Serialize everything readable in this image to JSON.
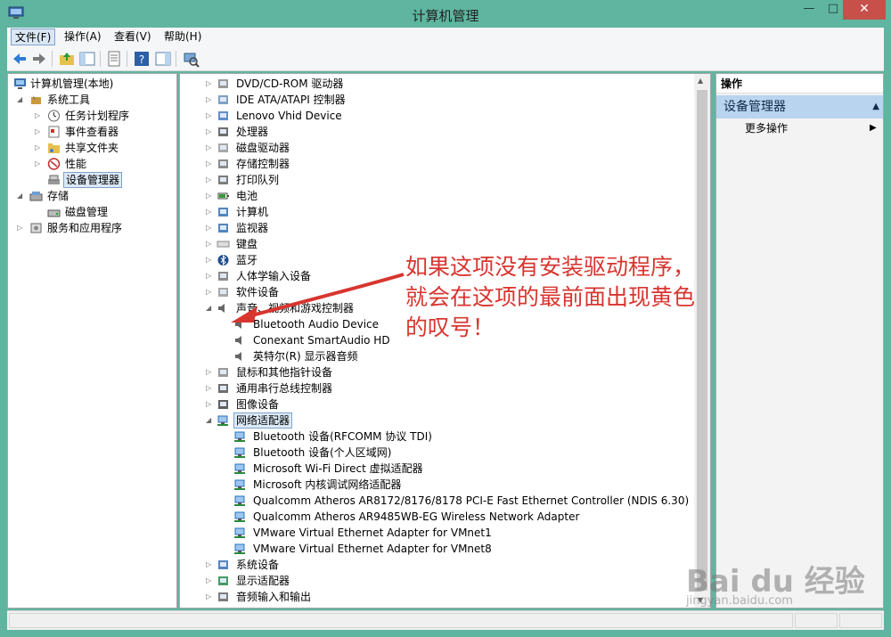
{
  "window": {
    "title": "计算机管理",
    "minimize": "—",
    "maximize": "□",
    "close": "✕"
  },
  "menu": [
    {
      "label": "文件(F)",
      "active": true
    },
    {
      "label": "操作(A)"
    },
    {
      "label": "查看(V)"
    },
    {
      "label": "帮助(H)"
    }
  ],
  "toolbar": [
    "back-arrow-icon",
    "forward-arrow-icon",
    "folder-up-icon",
    "show-hide-tree-icon",
    "properties-icon",
    "help-icon",
    "show-action-pane-icon",
    "scan-hardware-icon"
  ],
  "left_tree": [
    {
      "label": "计算机管理(本地)",
      "icon": "computer-management-icon"
    },
    {
      "label": "系统工具",
      "icon": "system-tools-icon"
    },
    {
      "label": "任务计划程序",
      "icon": "clock-icon"
    },
    {
      "label": "事件查看器",
      "icon": "event-viewer-icon"
    },
    {
      "label": "共享文件夹",
      "icon": "shared-folder-icon"
    },
    {
      "label": "性能",
      "icon": "performance-icon"
    },
    {
      "label": "设备管理器",
      "icon": "device-manager-icon",
      "selected": true
    },
    {
      "label": "存储",
      "icon": "storage-icon"
    },
    {
      "label": "磁盘管理",
      "icon": "disk-management-icon"
    },
    {
      "label": "服务和应用程序",
      "icon": "services-icon"
    }
  ],
  "device_tree": [
    {
      "label": "DVD/CD-ROM 驱动器",
      "icon": "dvd-drive-icon"
    },
    {
      "label": "IDE ATA/ATAPI 控制器",
      "icon": "ide-controller-icon"
    },
    {
      "label": "Lenovo Vhid Device",
      "icon": "hid-device-icon"
    },
    {
      "label": "处理器",
      "icon": "processor-icon"
    },
    {
      "label": "磁盘驱动器",
      "icon": "disk-drive-icon"
    },
    {
      "label": "存储控制器",
      "icon": "storage-controller-icon"
    },
    {
      "label": "打印队列",
      "icon": "printer-icon"
    },
    {
      "label": "电池",
      "icon": "battery-icon"
    },
    {
      "label": "计算机",
      "icon": "computer-icon"
    },
    {
      "label": "监视器",
      "icon": "monitor-icon"
    },
    {
      "label": "键盘",
      "icon": "keyboard-icon"
    },
    {
      "label": "蓝牙",
      "icon": "bluetooth-icon"
    },
    {
      "label": "人体学输入设备",
      "icon": "hid-icon"
    },
    {
      "label": "软件设备",
      "icon": "software-device-icon"
    },
    {
      "label": "声音、视频和游戏控制器",
      "icon": "speaker-icon",
      "expanded": true
    },
    {
      "label": "Bluetooth Audio Device",
      "icon": "speaker-icon",
      "child": true
    },
    {
      "label": "Conexant SmartAudio HD",
      "icon": "speaker-icon",
      "child": true
    },
    {
      "label": "英特尔(R) 显示器音频",
      "icon": "speaker-icon",
      "child": true
    },
    {
      "label": "鼠标和其他指针设备",
      "icon": "mouse-icon"
    },
    {
      "label": "通用串行总线控制器",
      "icon": "usb-icon"
    },
    {
      "label": "图像设备",
      "icon": "camera-icon"
    },
    {
      "label": "网络适配器",
      "icon": "network-adapter-icon",
      "expanded": true,
      "selected": true
    },
    {
      "label": "Bluetooth 设备(RFCOMM 协议 TDI)",
      "icon": "network-adapter-icon",
      "child": true
    },
    {
      "label": "Bluetooth 设备(个人区域网)",
      "icon": "network-adapter-icon",
      "child": true
    },
    {
      "label": "Microsoft Wi-Fi Direct 虚拟适配器",
      "icon": "network-adapter-icon",
      "child": true
    },
    {
      "label": "Microsoft 内核调试网络适配器",
      "icon": "network-adapter-icon",
      "child": true
    },
    {
      "label": "Qualcomm Atheros AR8172/8176/8178 PCI-E Fast Ethernet Controller (NDIS 6.30)",
      "icon": "network-adapter-icon",
      "child": true
    },
    {
      "label": "Qualcomm Atheros AR9485WB-EG Wireless Network Adapter",
      "icon": "network-adapter-icon",
      "child": true
    },
    {
      "label": "VMware Virtual Ethernet Adapter for VMnet1",
      "icon": "network-adapter-icon",
      "child": true
    },
    {
      "label": "VMware Virtual Ethernet Adapter for VMnet8",
      "icon": "network-adapter-icon",
      "child": true
    },
    {
      "label": "系统设备",
      "icon": "system-device-icon"
    },
    {
      "label": "显示适配器",
      "icon": "display-adapter-icon"
    },
    {
      "label": "音频输入和输出",
      "icon": "audio-io-icon"
    }
  ],
  "actions": {
    "header": "操作",
    "section": "设备管理器",
    "more": "更多操作"
  },
  "annotation": {
    "text": "如果这项没有安装驱动程序，就会在这项的最前面出现黄色的叹号！"
  },
  "watermark": {
    "brand": "Bai du 经验",
    "url": "jingyan.baidu.com"
  },
  "colors": {
    "titlebar": "#5fb5a0",
    "selection": "#dceaf8",
    "annotation": "#d8352f",
    "close": "#c7504a"
  }
}
